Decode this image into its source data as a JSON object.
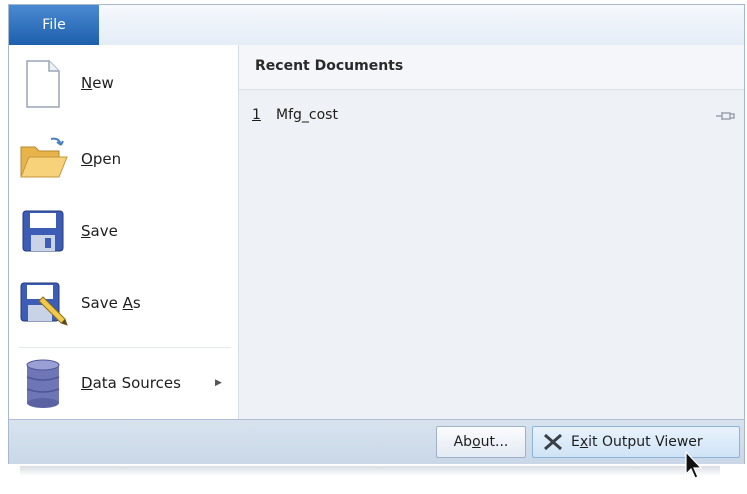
{
  "ribbon": {
    "file_tab": "File"
  },
  "commands": {
    "new": {
      "prefix": "",
      "key": "N",
      "suffix": "ew"
    },
    "open": {
      "prefix": "",
      "key": "O",
      "suffix": "pen"
    },
    "save": {
      "prefix": "",
      "key": "S",
      "suffix": "ave"
    },
    "save_as": {
      "prefix": "Save ",
      "key": "A",
      "suffix": "s"
    },
    "data_sources": {
      "prefix": "",
      "key": "D",
      "suffix": "ata Sources",
      "arrow": "▶"
    }
  },
  "recent": {
    "title": "Recent Documents",
    "items": [
      {
        "number": "1",
        "name": "Mfg_cost"
      }
    ]
  },
  "buttons": {
    "about": {
      "prefix": "Ab",
      "key": "o",
      "suffix": "ut..."
    },
    "exit": {
      "prefix": "E",
      "key": "x",
      "suffix": "it Output Viewer"
    }
  },
  "icons": {
    "new": "document-icon",
    "open": "folder-open-icon",
    "save": "floppy-disk-icon",
    "save_as": "save-as-icon",
    "data_sources": "database-icon",
    "pin": "pin-icon",
    "exit": "close-icon"
  },
  "colors": {
    "file_tab": "#1e5fad",
    "exit_button": "#cfe3f6"
  }
}
